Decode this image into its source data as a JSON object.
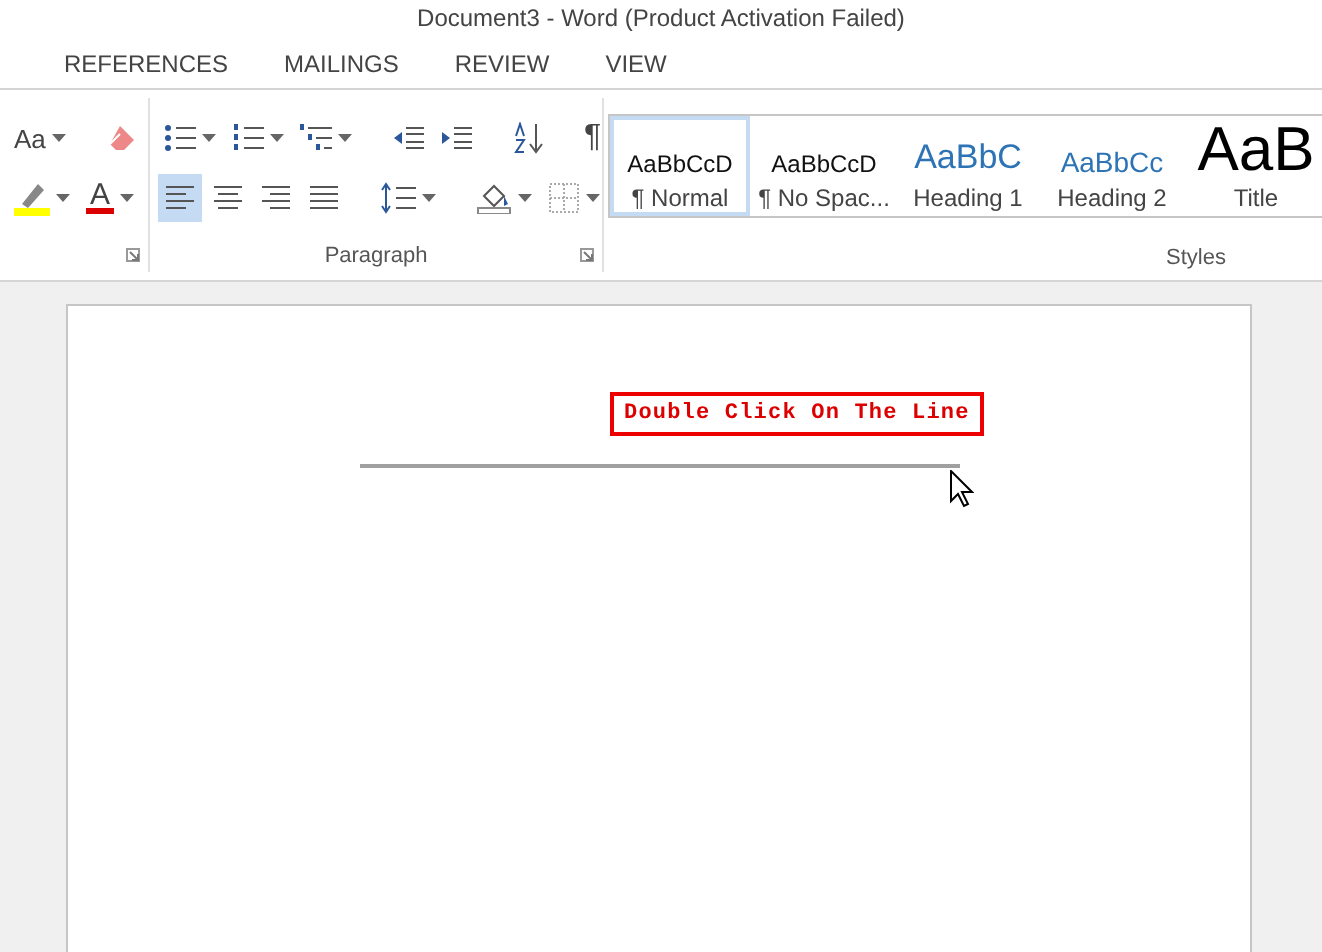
{
  "window": {
    "title": "Document3 - Word (Product Activation Failed)"
  },
  "tabs": [
    {
      "label": "REFERENCES",
      "selected": false
    },
    {
      "label": "MAILINGS",
      "selected": false
    },
    {
      "label": "REVIEW",
      "selected": false
    },
    {
      "label": "VIEW",
      "selected": false
    }
  ],
  "ribbon": {
    "font_group": {
      "change_case": "Aa",
      "font_color": "A"
    },
    "paragraph": {
      "label": "Paragraph",
      "show_marks": "¶",
      "alignments": [
        {
          "kind": "left",
          "selected": true
        },
        {
          "kind": "center",
          "selected": false
        },
        {
          "kind": "right",
          "selected": false
        },
        {
          "kind": "justify",
          "selected": false
        }
      ]
    },
    "styles": {
      "label": "Styles",
      "items": [
        {
          "kind": "normal",
          "preview": "AaBbCcD",
          "name": "¶ Normal",
          "selected": true
        },
        {
          "kind": "normal",
          "preview": "AaBbCcD",
          "name": "¶ No Spac...",
          "selected": false
        },
        {
          "kind": "heading1",
          "preview": "AaBbC",
          "name": "Heading 1",
          "selected": false
        },
        {
          "kind": "heading2",
          "preview": "AaBbCc",
          "name": "Heading 2",
          "selected": false
        },
        {
          "kind": "title",
          "preview": "AaB",
          "name": "Title",
          "selected": false
        }
      ]
    }
  },
  "document": {
    "callout": "Double Click On The Line"
  }
}
